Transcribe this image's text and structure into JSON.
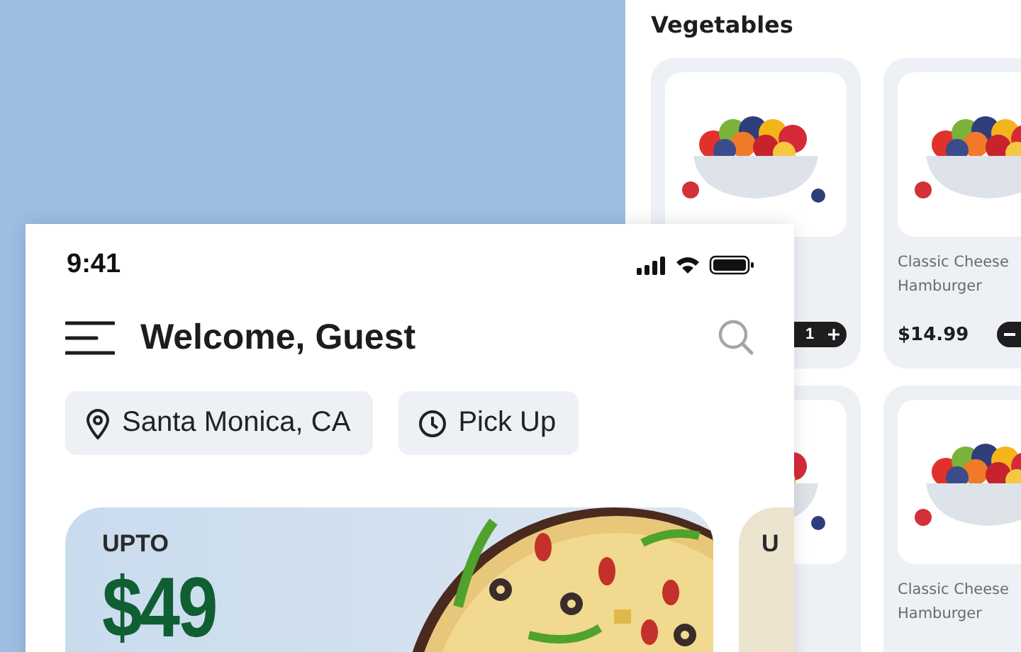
{
  "back_screen": {
    "title": "Vegetables",
    "products": [
      {
        "kind": "fruit-bowl",
        "quantity": "1"
      },
      {
        "kind": "fruit-bowl",
        "name": "Classic Cheese Hamburger",
        "price": "$14.99"
      },
      {
        "kind": "fruit-bowl"
      },
      {
        "kind": "fruit-bowl",
        "name": "Classic Cheese Hamburger"
      }
    ]
  },
  "front_screen": {
    "status_bar": {
      "time": "9:41"
    },
    "header": {
      "title": "Welcome, Guest"
    },
    "chips": [
      {
        "kind": "location",
        "label": "Santa Monica, CA"
      },
      {
        "kind": "time",
        "label": "Pick Up"
      }
    ],
    "promos": [
      {
        "kind": "pizza",
        "label": "UPTO",
        "amount": "$49"
      },
      {
        "kind": "plain",
        "label": "U"
      }
    ]
  }
}
